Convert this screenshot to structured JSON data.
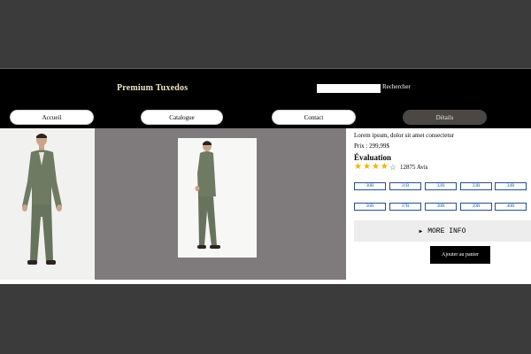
{
  "header": {
    "brand": "Premium Tuxedos",
    "search_placeholder": "",
    "search_button": "Rechercher"
  },
  "nav": {
    "items": [
      {
        "label": "Accueil"
      },
      {
        "label": "Catalogue"
      },
      {
        "label": "Contact"
      },
      {
        "label": "Détails"
      }
    ],
    "active_index": 3
  },
  "product": {
    "description": "Lorem ipsum, dolor sit amet consectetur",
    "price": "Prix : 299,99$",
    "evaluation_title": "Évaluation",
    "rating": 4,
    "rating_max": 5,
    "reviews": "12875 Avis",
    "sizes_row1": [
      "30R",
      "31R",
      "32R",
      "33R",
      "34R"
    ],
    "sizes_row2": [
      "36R",
      "37R",
      "38R",
      "39R",
      "40R"
    ],
    "more_info": "MORE INFO",
    "add_to_cart": "Ajouter au panier"
  },
  "colors": {
    "header_bg": "#000000",
    "active_tab": "#4a4744",
    "star": "#f0b400",
    "size_text": "#1a57c4",
    "suit": "#6e7a62"
  }
}
